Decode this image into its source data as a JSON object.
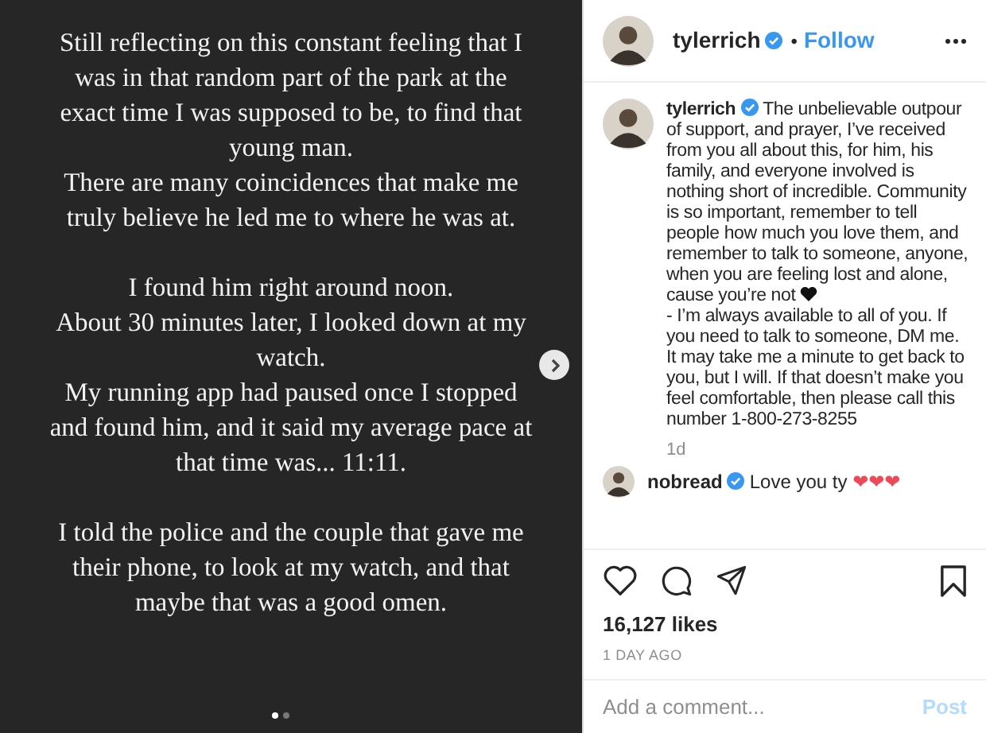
{
  "post_image": {
    "groups": [
      {
        "paragraphs": [
          "Still reflecting on this constant feeling that I was in that random part of the park at the exact time I was supposed to be, to find that young man.",
          "There are many coincidences that make me truly believe he led me to where he was at."
        ]
      },
      {
        "paragraphs": [
          "I found him right around noon.",
          "About 30 minutes later, I looked down at my watch.",
          "My running app had paused once I stopped and found him, and it said my average pace at that time was...  11:11."
        ]
      },
      {
        "paragraphs": [
          "I told the police and the couple that gave me their phone, to look at my watch, and that maybe that was a good omen."
        ]
      }
    ],
    "dots": [
      {
        "selected": true
      },
      {
        "selected": false
      }
    ]
  },
  "header": {
    "username": "tylerrich",
    "verified": true,
    "separator": "•",
    "follow": "Follow"
  },
  "caption": {
    "username": "tylerrich",
    "verified": true,
    "text_before_heart": "The unbelievable outpour of support, and prayer, I’ve received from you all about this, for him, his family, and everyone involved is nothing short of incredible. Community is so important, remember to tell people how much you love them, and remember to talk to someone, anyone, when you are feeling lost and alone, cause you’re not",
    "text_after_heart": "- I’m always available to all of you. If you need to talk to someone, DM me. It may take me a minute to get back to you, but I will. If that doesn’t make you feel comfortable, then please call this number 1-800-273-8255",
    "time": "1d"
  },
  "comments": [
    {
      "username": "nobread",
      "verified": true,
      "text": "Love you ty",
      "hearts": "❤❤❤"
    }
  ],
  "likes": "16,127 likes",
  "date": "1 DAY AGO",
  "comment_box": {
    "placeholder": "Add a comment...",
    "post": "Post",
    "disabled": true
  }
}
